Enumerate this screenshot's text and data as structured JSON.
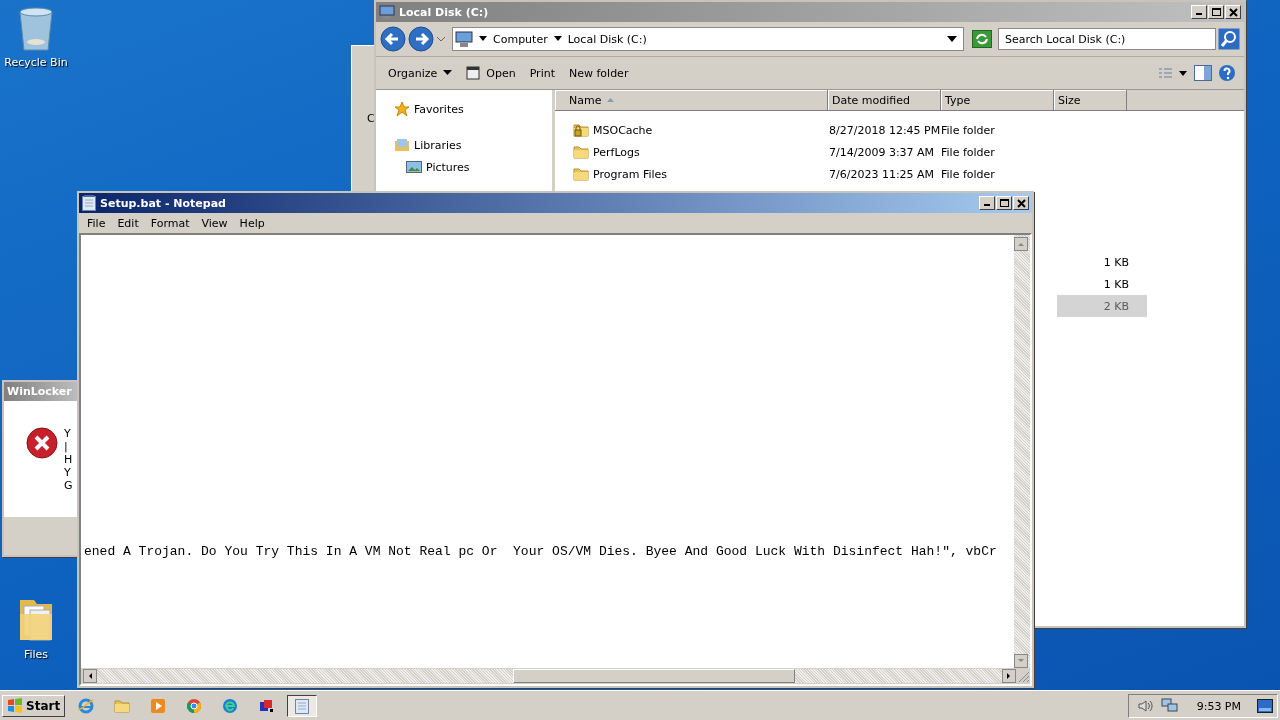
{
  "desktop_icons": [
    {
      "label": "Recycle Bin",
      "kind": "recycle"
    },
    {
      "label": "Files",
      "kind": "folder"
    }
  ],
  "back_window": {
    "label": "C"
  },
  "explorer": {
    "title": "Local Disk (C:)",
    "breadcrumbs": [
      "Computer",
      "Local Disk (C:)"
    ],
    "search": {
      "placeholder": "Search Local Disk (C:)"
    },
    "toolbar": [
      {
        "label": "Organize",
        "kind": "menu"
      },
      {
        "label": "Open",
        "kind": "open"
      },
      {
        "label": "Print",
        "kind": "plain"
      },
      {
        "label": "New folder",
        "kind": "plain"
      }
    ],
    "nav": [
      {
        "label": "Favorites",
        "kind": "star"
      },
      {
        "label": "Libraries",
        "kind": "library",
        "children": [
          {
            "label": "Pictures",
            "kind": "pictures"
          }
        ]
      }
    ],
    "columns": [
      "Name",
      "Date modified",
      "Type",
      "Size"
    ],
    "rows": [
      {
        "name": "MSOCache",
        "date": "8/27/2018 12:45 PM",
        "type": "File folder",
        "kind": "locked",
        "selected": false
      },
      {
        "name": "PerfLogs",
        "date": "7/14/2009 3:37 AM",
        "type": "File folder",
        "kind": "folder",
        "selected": false
      },
      {
        "name": "Program Files",
        "date": "7/6/2023 11:25 AM",
        "type": "File folder",
        "kind": "folder",
        "selected": false
      },
      {
        "size": "1 KB",
        "selected": false
      },
      {
        "size": "1 KB",
        "selected": false
      },
      {
        "size": "2 KB",
        "selected": true
      }
    ]
  },
  "dialog": {
    "title": "WinLocker",
    "lines": [
      "Y",
      "|",
      "H",
      "Y",
      "G"
    ]
  },
  "notepad": {
    "title": "Setup.bat - Notepad",
    "menu": [
      "File",
      "Edit",
      "Format",
      "View",
      "Help"
    ],
    "text": "ened A Trojan. Do You Try This In A VM Not Real pc Or  Your OS/VM Dies. Byee And Good Luck With Disinfect Hah!\", vbCr"
  },
  "taskbar": {
    "start": "Start",
    "apps": [
      {
        "kind": "ie",
        "selected": false
      },
      {
        "kind": "explorer",
        "selected": false
      },
      {
        "kind": "media",
        "selected": false
      },
      {
        "kind": "chrome",
        "selected": false
      },
      {
        "kind": "edge",
        "selected": false
      },
      {
        "kind": "app",
        "selected": false
      },
      {
        "kind": "notepad",
        "selected": true
      }
    ],
    "clock": "9:53 PM"
  }
}
